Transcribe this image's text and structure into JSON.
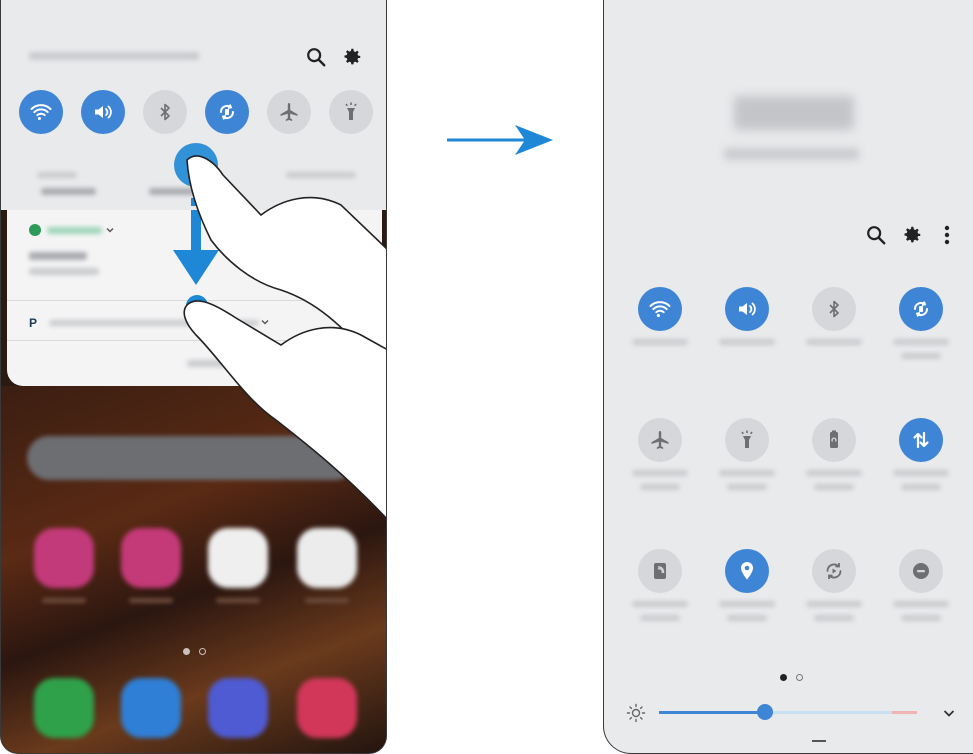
{
  "arrow": {
    "color": "#1e88d6"
  },
  "left_panel": {
    "quick_toggles": [
      {
        "icon": "wifi-icon",
        "on": true
      },
      {
        "icon": "volume-icon",
        "on": true
      },
      {
        "icon": "bluetooth-icon",
        "on": false
      },
      {
        "icon": "auto-rotate-icon",
        "on": true
      },
      {
        "icon": "airplane-icon",
        "on": false
      },
      {
        "icon": "flashlight-icon",
        "on": false
      }
    ],
    "header_icons": [
      "search-icon",
      "gear-icon"
    ],
    "pagination": {
      "pages": 2,
      "current": 1
    },
    "apps": [
      "store-icon",
      "flower-icon",
      "play-store-icon",
      "google-folder-icon",
      "phone-icon",
      "messages-icon",
      "browser-icon",
      "camera-icon"
    ],
    "gesture": "swipe-down-hand"
  },
  "right_panel": {
    "header_icons": [
      "search-icon",
      "gear-icon",
      "more-icon"
    ],
    "quick_toggles": [
      {
        "icon": "wifi-icon",
        "on": true
      },
      {
        "icon": "volume-icon",
        "on": true
      },
      {
        "icon": "bluetooth-icon",
        "on": false
      },
      {
        "icon": "auto-rotate-icon",
        "on": true
      },
      {
        "icon": "airplane-icon",
        "on": false
      },
      {
        "icon": "flashlight-icon",
        "on": false
      },
      {
        "icon": "power-saving-icon",
        "on": false
      },
      {
        "icon": "mobile-data-icon",
        "on": true
      },
      {
        "icon": "nfc-icon",
        "on": false
      },
      {
        "icon": "location-icon",
        "on": true
      },
      {
        "icon": "sync-icon",
        "on": false
      },
      {
        "icon": "do-not-disturb-icon",
        "on": false
      }
    ],
    "pagination": {
      "pages": 2,
      "current": 1
    },
    "brightness": {
      "level": 0.5,
      "icon": "sun-icon",
      "expand_icon": "chevron-down-icon"
    },
    "colors": {
      "accent": "#3f85d6",
      "panel": "#e9eaec",
      "toggle_off": "#d6d7da"
    }
  }
}
